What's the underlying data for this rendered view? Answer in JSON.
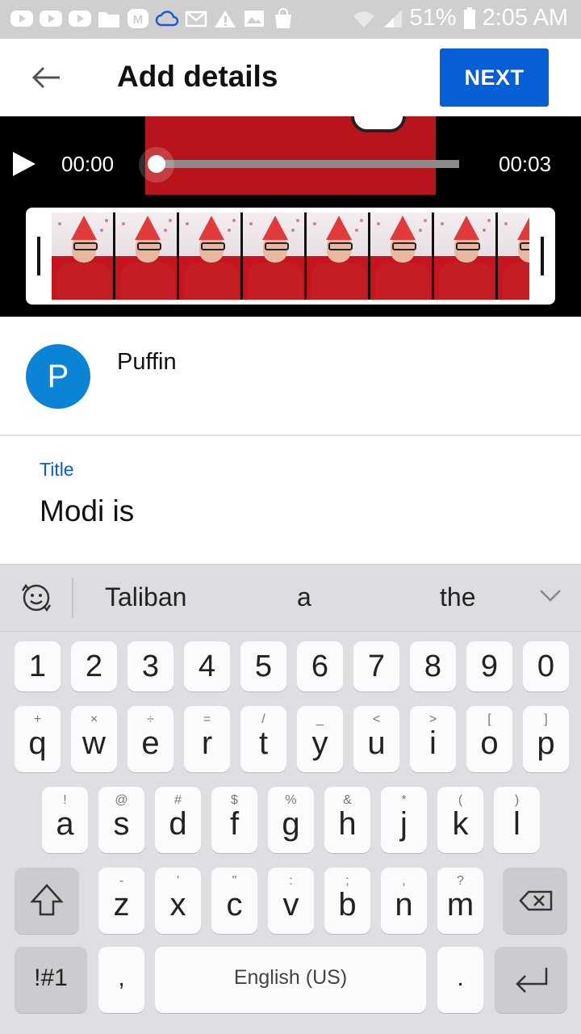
{
  "status_bar": {
    "battery": "51%",
    "time": "2:05 AM",
    "icons": [
      "youtube-icon",
      "youtube-icon",
      "youtube-icon",
      "folder-icon",
      "gmail-icon",
      "cloud-icon",
      "mail-icon",
      "warning-icon",
      "image-icon",
      "shopping-bag-icon",
      "wifi-icon",
      "signal-icon",
      "battery-icon"
    ]
  },
  "app_bar": {
    "title": "Add details",
    "next_label": "NEXT",
    "accent_color": "#065fd4"
  },
  "player": {
    "current_time": "00:00",
    "duration": "00:03",
    "progress": 0
  },
  "channel": {
    "avatar_letter": "P",
    "avatar_color": "#0b84d6",
    "name": "Puffin"
  },
  "form": {
    "title_label": "Title",
    "title_value": "Modi is"
  },
  "keyboard": {
    "suggestions": [
      "Taliban",
      "a",
      "the"
    ],
    "numbers": [
      "1",
      "2",
      "3",
      "4",
      "5",
      "6",
      "7",
      "8",
      "9",
      "0"
    ],
    "row1": [
      [
        "q",
        "+"
      ],
      [
        "w",
        "×"
      ],
      [
        "e",
        "÷"
      ],
      [
        "r",
        "="
      ],
      [
        "t",
        "/"
      ],
      [
        "y",
        "_"
      ],
      [
        "u",
        "<"
      ],
      [
        "i",
        ">"
      ],
      [
        "o",
        "["
      ],
      [
        "p",
        "]"
      ]
    ],
    "row2": [
      [
        "a",
        "!"
      ],
      [
        "s",
        "@"
      ],
      [
        "d",
        "#"
      ],
      [
        "f",
        "$"
      ],
      [
        "g",
        "%"
      ],
      [
        "h",
        "&"
      ],
      [
        "j",
        "*"
      ],
      [
        "k",
        "("
      ],
      [
        "l",
        ")"
      ]
    ],
    "row3": [
      [
        "z",
        "-"
      ],
      [
        "x",
        "'"
      ],
      [
        "c",
        "\""
      ],
      [
        "v",
        ":"
      ],
      [
        "b",
        ";"
      ],
      [
        "n",
        ","
      ],
      [
        "m",
        "?"
      ]
    ],
    "symbols_key": "!#1",
    "comma_key": ",",
    "space_label": "English (US)",
    "period_key": "."
  }
}
